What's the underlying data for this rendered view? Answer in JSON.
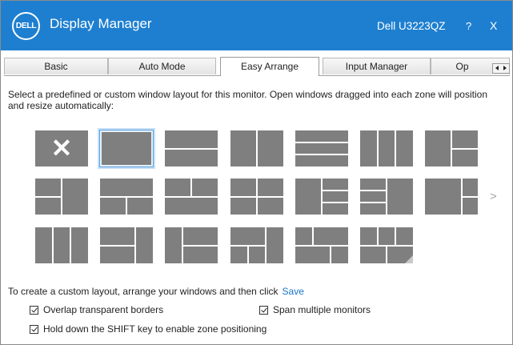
{
  "titlebar": {
    "logo_text": "DELL",
    "app_title": "Display Manager",
    "monitor_name": "Dell U3223QZ",
    "help_label": "?",
    "close_label": "X"
  },
  "tabs": [
    {
      "label": "Basic",
      "active": false
    },
    {
      "label": "Auto Mode",
      "active": false
    },
    {
      "label": "Easy Arrange",
      "active": true
    },
    {
      "label": "Input Manager",
      "active": false
    },
    {
      "label": "Op",
      "active": false
    }
  ],
  "instructions": "Select a predefined or custom window layout for this monitor.  Open windows dragged into each zone will position and resize automatically:",
  "layouts": {
    "count": 20,
    "selected_index": 1,
    "first_is_none": true,
    "none_icon": "x-icon"
  },
  "next_arrow": ">",
  "custom": {
    "text": "To create a custom layout, arrange your windows and then click",
    "save_label": "Save"
  },
  "options": [
    {
      "label": "Overlap transparent borders",
      "checked": true
    },
    {
      "label": "Span multiple monitors",
      "checked": true
    },
    {
      "label": "Hold down the SHIFT key to enable zone positioning",
      "checked": true
    }
  ],
  "colors": {
    "titlebar": "#1e7fd0",
    "zone_fill": "#7f7f7f",
    "link": "#1a74c8",
    "selection": "#58a0dc"
  }
}
